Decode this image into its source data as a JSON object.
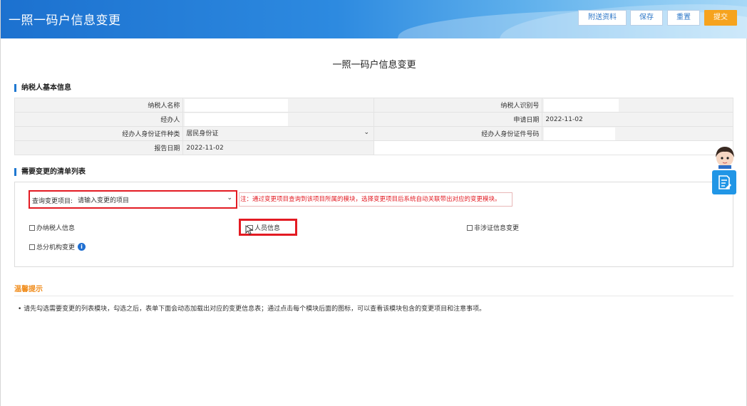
{
  "header": {
    "title": "一照一码户信息变更",
    "buttons": {
      "attach": "附送资料",
      "save": "保存",
      "reset": "重置",
      "submit": "提交"
    }
  },
  "page_title": "一照一码户信息变更",
  "basic_section": {
    "title": "纳税人基本信息",
    "fields": {
      "taxpayer_name_label": "纳税人名称",
      "taxpayer_id_label": "纳税人识别号",
      "agent_label": "经办人",
      "apply_date_label": "申请日期",
      "apply_date_value": "2022-11-02",
      "agent_id_type_label": "经办人身份证件种类",
      "agent_id_type_value": "居民身份证",
      "agent_id_no_label": "经办人身份证件号码",
      "report_date_label": "报告日期",
      "report_date_value": "2022-11-02"
    }
  },
  "change_section": {
    "title": "需要变更的清单列表",
    "query_label": "查询变更项目:",
    "query_placeholder": "请输入变更的项目",
    "note": "注：通过变更项目查询到该项目所属的模块，选择变更项目后系统自动关联带出对应的变更模块。",
    "checkboxes": {
      "taxpayer_info": "办纳税人信息",
      "personnel_info": "人员信息",
      "non_cert_info": "非涉证信息变更",
      "branch_change": "总分机构变更"
    }
  },
  "tips": {
    "title": "温馨提示",
    "text": "• 请先勾选需要变更的列表模块，勾选之后，表单下面会动态加载出对应的变更信息表；通过点击每个模块后面的图标，可以查看该模块包含的变更项目和注意事项。"
  },
  "colors": {
    "primary": "#1f78d1",
    "submit": "#f6a31e",
    "highlight": "#e31b23",
    "tip_title": "#f08c1b"
  },
  "icons": {
    "chevron": "chevron-down-icon",
    "info": "info-icon",
    "cursor": "pointer-cursor-icon",
    "assistant": "assistant-avatar-icon",
    "side": "document-edit-icon"
  }
}
